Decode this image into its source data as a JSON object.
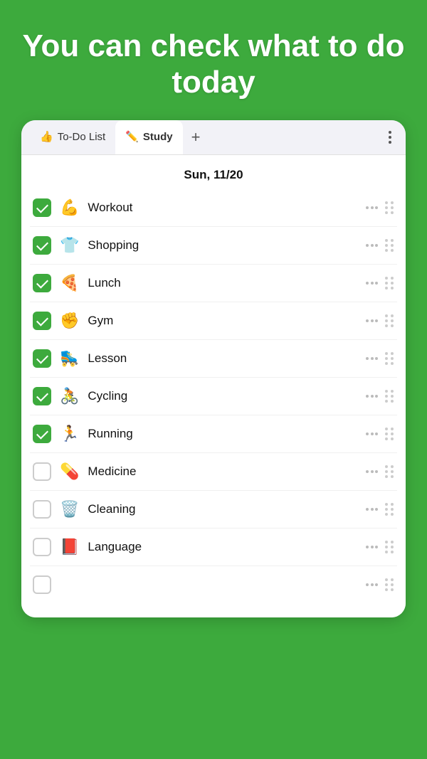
{
  "hero": {
    "title": "You can check what to do today"
  },
  "tabs": [
    {
      "id": "todo",
      "emoji": "👍",
      "label": "To-Do List",
      "active": false
    },
    {
      "id": "study",
      "emoji": "✏️",
      "label": "Study",
      "active": true
    }
  ],
  "tab_add_label": "+",
  "date": "Sun, 11/20",
  "tasks": [
    {
      "id": 1,
      "emoji": "💪",
      "label": "Workout",
      "checked": true
    },
    {
      "id": 2,
      "emoji": "👕",
      "label": "Shopping",
      "checked": true
    },
    {
      "id": 3,
      "emoji": "🍕",
      "label": "Lunch",
      "checked": true
    },
    {
      "id": 4,
      "emoji": "✊",
      "label": "Gym",
      "checked": true
    },
    {
      "id": 5,
      "emoji": "🛼",
      "label": "Lesson",
      "checked": true
    },
    {
      "id": 6,
      "emoji": "🚴",
      "label": "Cycling",
      "checked": true
    },
    {
      "id": 7,
      "emoji": "🏃",
      "label": "Running",
      "checked": true
    },
    {
      "id": 8,
      "emoji": "💊",
      "label": "Medicine",
      "checked": false
    },
    {
      "id": 9,
      "emoji": "🗑️",
      "label": "Cleaning",
      "checked": false
    },
    {
      "id": 10,
      "emoji": "📕",
      "label": "Language",
      "checked": false
    },
    {
      "id": 11,
      "emoji": "",
      "label": "",
      "checked": false
    }
  ]
}
